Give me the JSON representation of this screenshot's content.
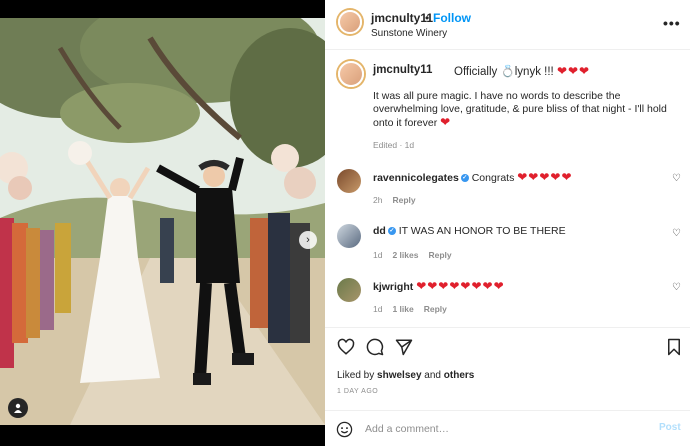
{
  "post": {
    "username": "jmcnulty11",
    "separator": "•",
    "follow_label": "Follow",
    "location": "Sunstone Winery",
    "more_icon": "more-dots-icon",
    "caption": {
      "username": "jmcnulty11",
      "intro": "Officially 💍lynyk !!! ",
      "hearts": "❤❤❤",
      "body": "It was all pure magic. I have no words to describe the overwhelming love, gratitude, & pure bliss of that night - I'll hold onto it forever ",
      "body_heart": "❤",
      "meta": "Edited · 1d"
    }
  },
  "comments": [
    {
      "username": "ravennicolegates",
      "verified": true,
      "text": "Congrats ",
      "hearts": "❤❤❤❤❤",
      "time": "2h",
      "likes": "",
      "reply": "Reply"
    },
    {
      "username": "dd",
      "verified": true,
      "text": "IT WAS AN HONOR TO BE THERE",
      "hearts": "",
      "time": "1d",
      "likes": "2 likes",
      "reply": "Reply"
    },
    {
      "username": "kjwright",
      "verified": false,
      "text": "",
      "hearts": "❤❤❤❤❤❤❤❤",
      "time": "1d",
      "likes": "1 like",
      "reply": "Reply"
    }
  ],
  "actions": {
    "liked_by_prefix": "Liked by ",
    "liked_by_user": "shwelsey",
    "liked_by_and": " and ",
    "liked_by_others": "others",
    "date": "1 DAY AGO",
    "comment_placeholder": "Add a comment…",
    "post_label": "Post"
  },
  "colors": {
    "follow": "#0095f6",
    "heart": "#e0202d",
    "verified": "#3897f0",
    "post_disabled": "#b2dffc"
  },
  "carousel": {
    "slides": 2,
    "active_index": 0
  }
}
